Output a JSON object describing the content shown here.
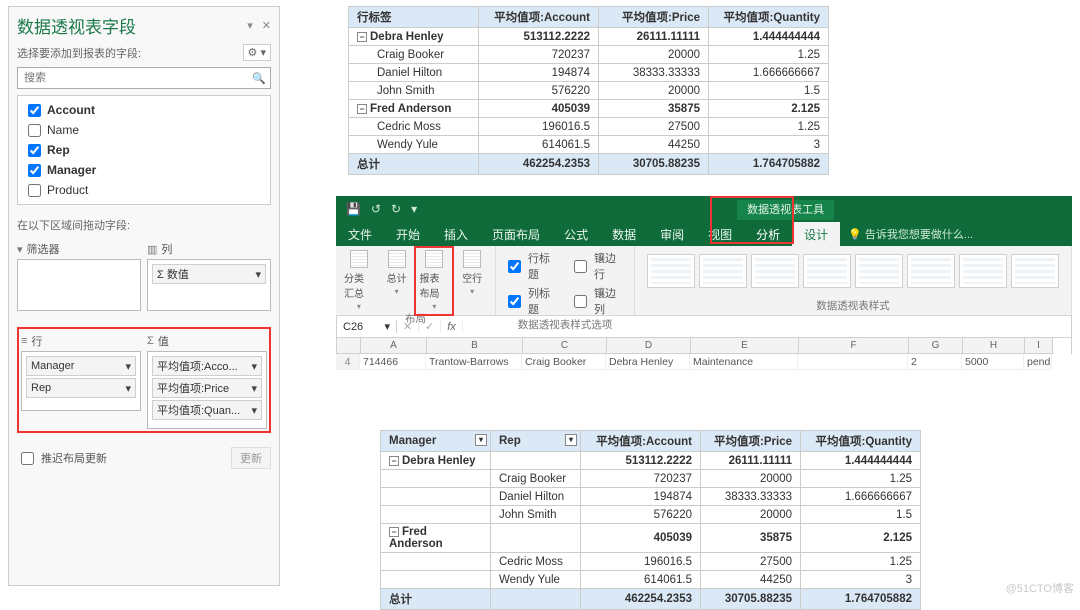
{
  "fieldlist": {
    "title": "数据透视表字段",
    "subtitle": "选择要添加到报表的字段:",
    "search_placeholder": "搜索",
    "fields": [
      {
        "name": "Account",
        "checked": true
      },
      {
        "name": "Name",
        "checked": false
      },
      {
        "name": "Rep",
        "checked": true
      },
      {
        "name": "Manager",
        "checked": true
      },
      {
        "name": "Product",
        "checked": false
      }
    ],
    "drag_label": "在以下区域间拖动字段:",
    "areas": {
      "filters": {
        "title": "筛选器"
      },
      "columns": {
        "title": "列",
        "chips": [
          "Σ 数值"
        ]
      },
      "rows": {
        "title": "行",
        "chips": [
          "Manager",
          "Rep"
        ]
      },
      "values": {
        "title": "值",
        "chips": [
          "平均值项:Acco...",
          "平均值项:Price",
          "平均值项:Quan..."
        ]
      }
    },
    "footer": {
      "defer": "推迟布局更新",
      "update": "更新"
    }
  },
  "pivot_top": {
    "headers": [
      "行标签",
      "平均值项:Account",
      "平均值项:Price",
      "平均值项:Quantity"
    ],
    "rows": [
      {
        "type": "mgr",
        "label": "Debra Henley",
        "acc": "513112.2222",
        "price": "26111.11111",
        "qty": "1.444444444"
      },
      {
        "type": "rep",
        "label": "Craig Booker",
        "acc": "720237",
        "price": "20000",
        "qty": "1.25"
      },
      {
        "type": "rep",
        "label": "Daniel Hilton",
        "acc": "194874",
        "price": "38333.33333",
        "qty": "1.666666667"
      },
      {
        "type": "rep",
        "label": "John Smith",
        "acc": "576220",
        "price": "20000",
        "qty": "1.5"
      },
      {
        "type": "mgr",
        "label": "Fred Anderson",
        "acc": "405039",
        "price": "35875",
        "qty": "2.125"
      },
      {
        "type": "rep",
        "label": "Cedric Moss",
        "acc": "196016.5",
        "price": "27500",
        "qty": "1.25"
      },
      {
        "type": "rep",
        "label": "Wendy Yule",
        "acc": "614061.5",
        "price": "44250",
        "qty": "3"
      }
    ],
    "grand": {
      "label": "总计",
      "acc": "462254.2353",
      "price": "30705.88235",
      "qty": "1.764705882"
    }
  },
  "ribbon": {
    "context_title": "数据透视表工具",
    "tabs": [
      "文件",
      "开始",
      "插入",
      "页面布局",
      "公式",
      "数据",
      "审阅",
      "视图"
    ],
    "ctx_tabs": [
      "分析",
      "设计"
    ],
    "tellme": "告诉我您想要做什么...",
    "group_layout": {
      "buttons": [
        "分类汇总",
        "总计",
        "报表布局",
        "空行"
      ],
      "label": "布局"
    },
    "group_styleopts": {
      "checks": [
        {
          "label": "行标题",
          "checked": true
        },
        {
          "label": "镶边行",
          "checked": false
        },
        {
          "label": "列标题",
          "checked": true
        },
        {
          "label": "镶边列",
          "checked": false
        }
      ],
      "label": "数据透视表样式选项"
    },
    "group_styles": {
      "label": "数据透视表样式"
    },
    "namebox": "C26",
    "columns": [
      "A",
      "B",
      "C",
      "D",
      "E",
      "F",
      "G",
      "H",
      "I"
    ],
    "sample_row_num": "4",
    "sample_row": [
      "714466",
      "Trantow-Barrows",
      "Craig Booker",
      "Debra Henley",
      "Maintenance",
      "",
      "2",
      "5000",
      "pending"
    ]
  },
  "pivot_bottom": {
    "headers": [
      "Manager",
      "Rep",
      "平均值项:Account",
      "平均值项:Price",
      "平均值项:Quantity"
    ],
    "rows": [
      {
        "type": "mgr",
        "mgr": "Debra Henley",
        "rep": "",
        "acc": "513112.2222",
        "price": "26111.11111",
        "qty": "1.444444444"
      },
      {
        "type": "rep",
        "mgr": "",
        "rep": "Craig Booker",
        "acc": "720237",
        "price": "20000",
        "qty": "1.25"
      },
      {
        "type": "rep",
        "mgr": "",
        "rep": "Daniel Hilton",
        "acc": "194874",
        "price": "38333.33333",
        "qty": "1.666666667"
      },
      {
        "type": "rep",
        "mgr": "",
        "rep": "John Smith",
        "acc": "576220",
        "price": "20000",
        "qty": "1.5"
      },
      {
        "type": "mgr",
        "mgr": "Fred Anderson",
        "rep": "",
        "acc": "405039",
        "price": "35875",
        "qty": "2.125"
      },
      {
        "type": "rep",
        "mgr": "",
        "rep": "Cedric Moss",
        "acc": "196016.5",
        "price": "27500",
        "qty": "1.25"
      },
      {
        "type": "rep",
        "mgr": "",
        "rep": "Wendy Yule",
        "acc": "614061.5",
        "price": "44250",
        "qty": "3"
      }
    ],
    "grand": {
      "label": "总计",
      "acc": "462254.2353",
      "price": "30705.88235",
      "qty": "1.764705882"
    }
  },
  "watermark": "@51CTO博客"
}
